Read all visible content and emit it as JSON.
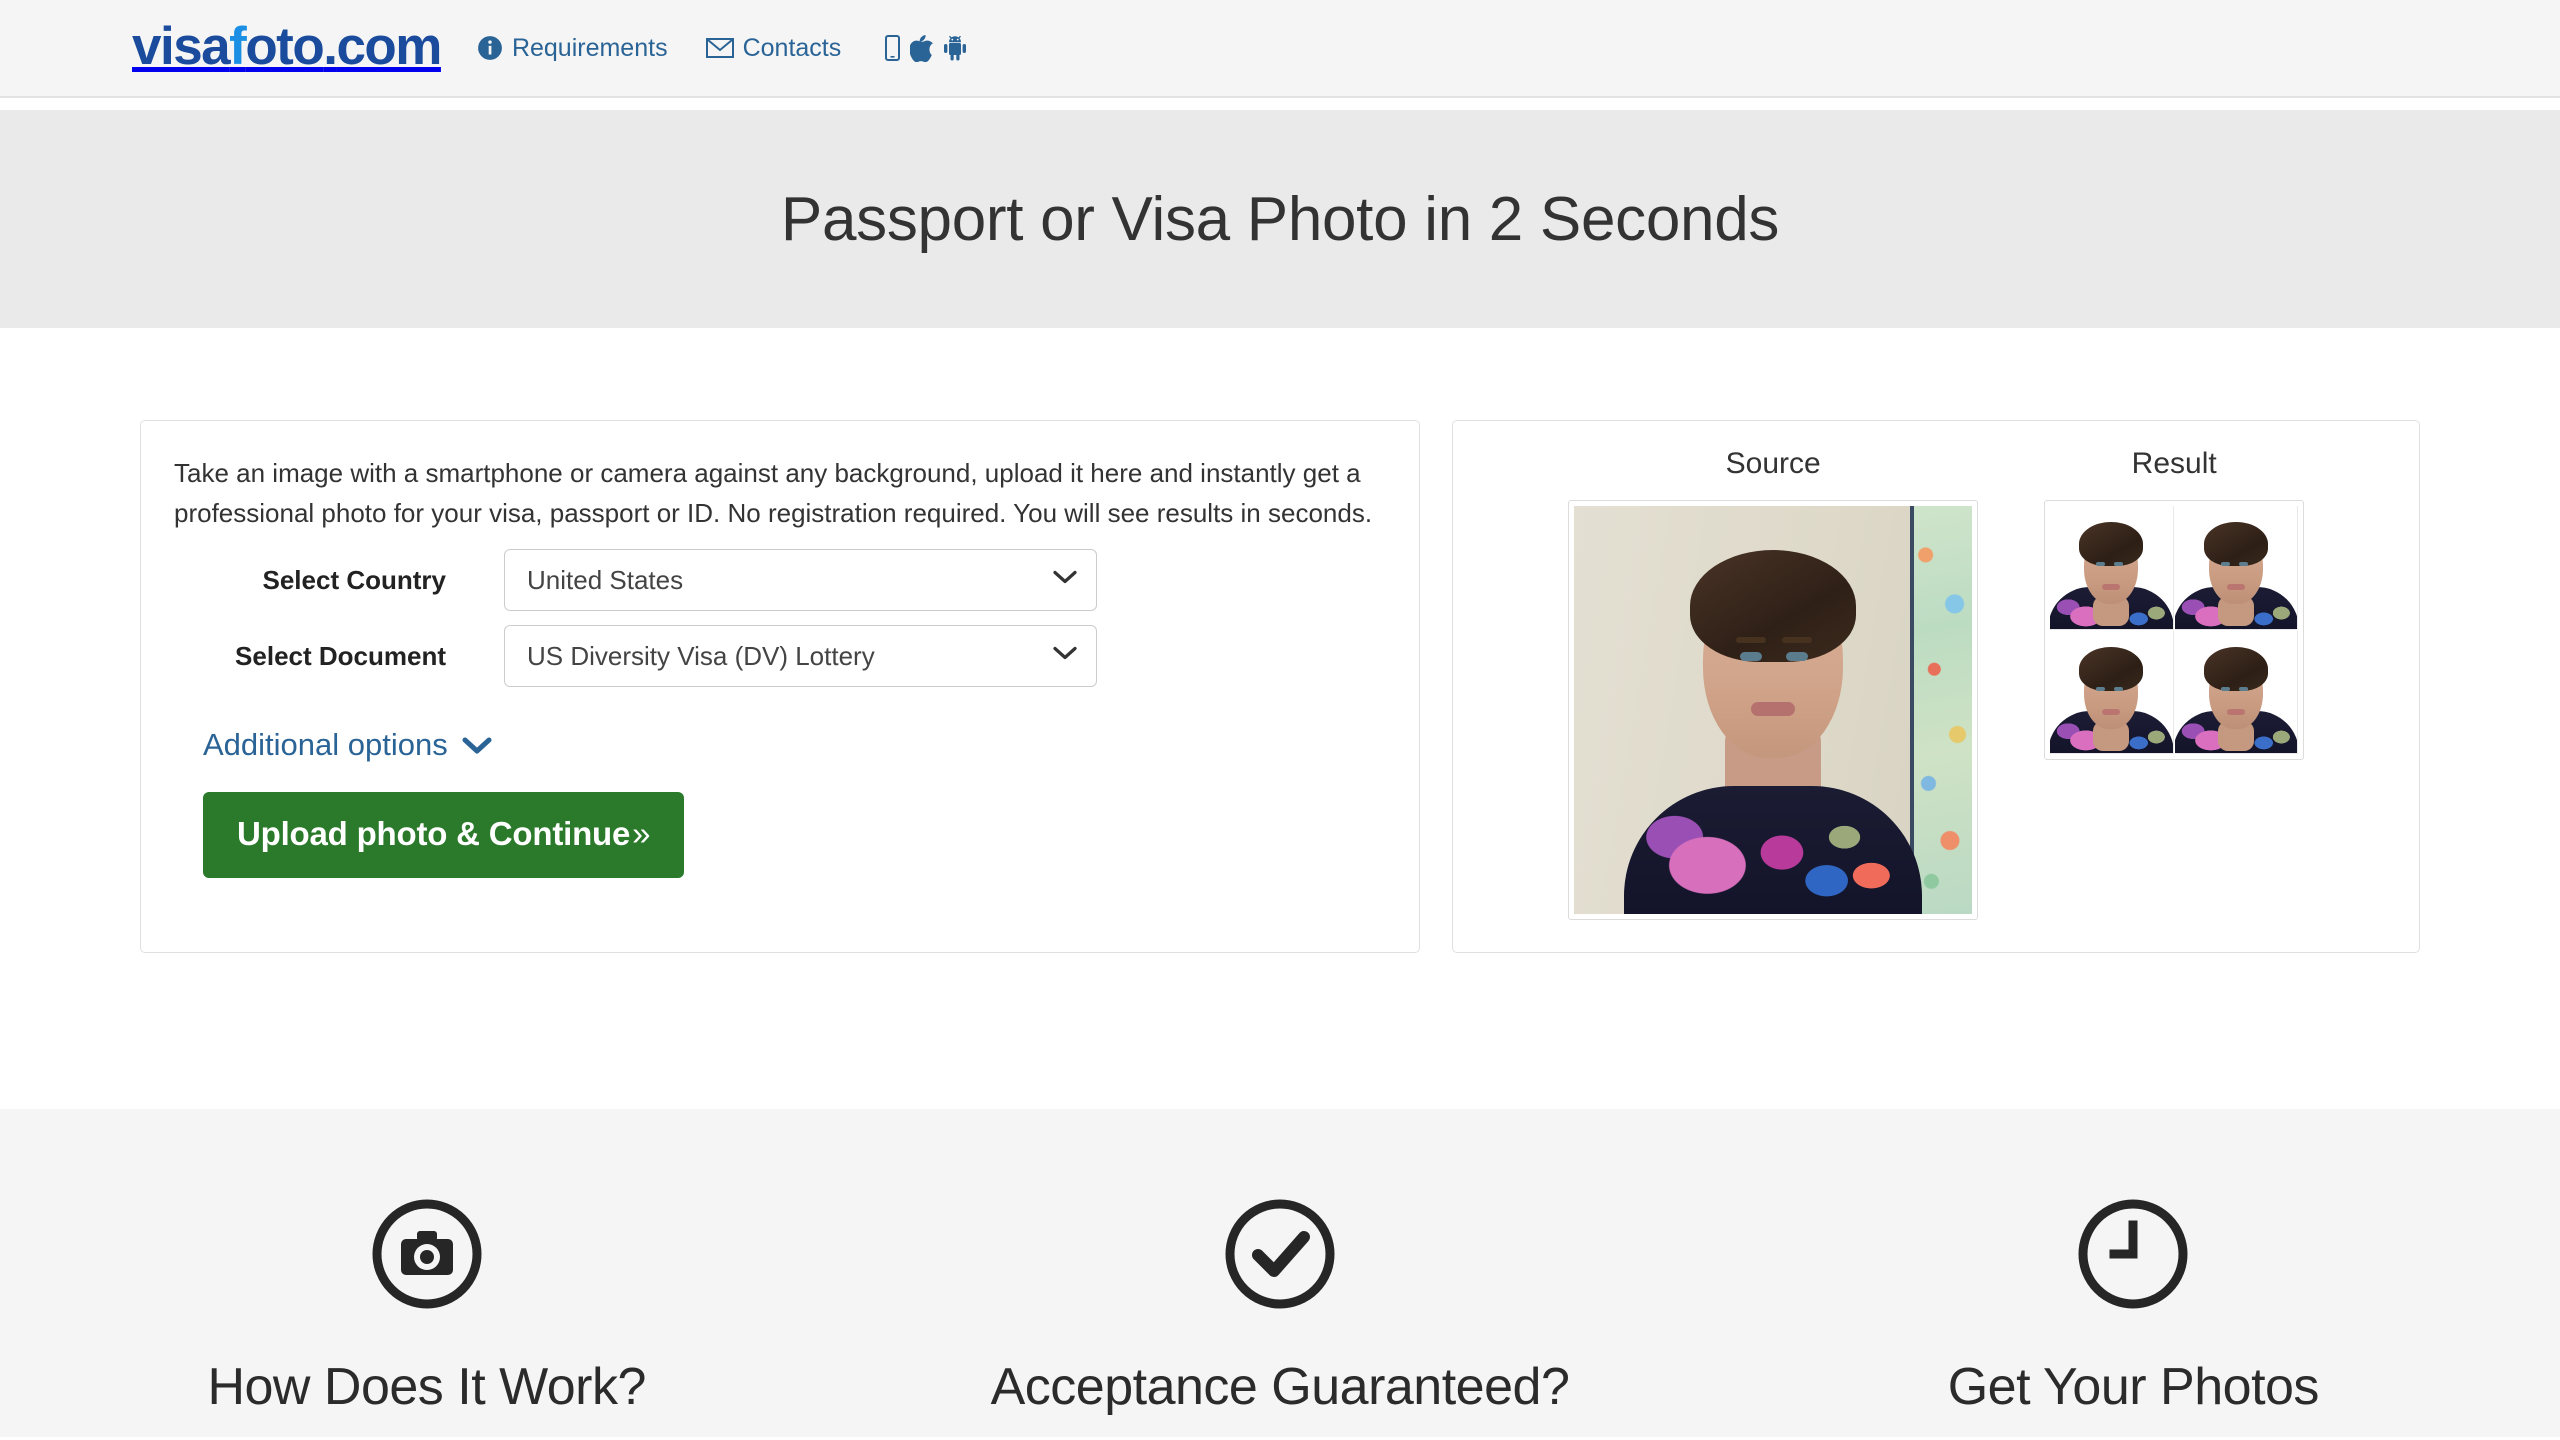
{
  "header": {
    "brand": {
      "part1": "visa",
      "part2": "f",
      "part3": "oto",
      "dot": ".",
      "part4": "com"
    },
    "nav": [
      {
        "label": "Requirements",
        "icon": "info-circle-icon"
      },
      {
        "label": "Contacts",
        "icon": "envelope-icon"
      }
    ],
    "app_icons": [
      "mobile-icon",
      "apple-icon",
      "android-icon"
    ],
    "accent_color": "#2a6496",
    "brand_dark": "#1a4b9c",
    "brand_light": "#1a8fe3"
  },
  "hero": {
    "title": "Passport or Visa Photo in 2 Seconds",
    "background": "#eaeaea"
  },
  "upload_card": {
    "intro": "Take an image with a smartphone or camera against any background, upload it here and instantly get a professional photo for your visa, passport or ID. No registration required. You will see results in seconds.",
    "country": {
      "label": "Select Country",
      "value": "United States",
      "caret": "chevron-down-icon"
    },
    "document": {
      "label": "Select Document",
      "value": "US Diversity Visa (DV) Lottery",
      "caret": "chevron-down-icon"
    },
    "additional_options": {
      "label": "Additional options",
      "icon": "chevron-down-icon"
    },
    "upload_button": {
      "label": "Upload photo & Continue",
      "chevron": "»",
      "color": "#2b7a2b"
    }
  },
  "preview_card": {
    "source": {
      "title": "Source"
    },
    "result": {
      "title": "Result"
    }
  },
  "features": [
    {
      "title": "How Does It Work?",
      "icon": "camera-circle-icon"
    },
    {
      "title": "Acceptance Guaranteed?",
      "icon": "check-circle-icon"
    },
    {
      "title": "Get Your Photos",
      "icon": "clock-circle-icon"
    }
  ]
}
